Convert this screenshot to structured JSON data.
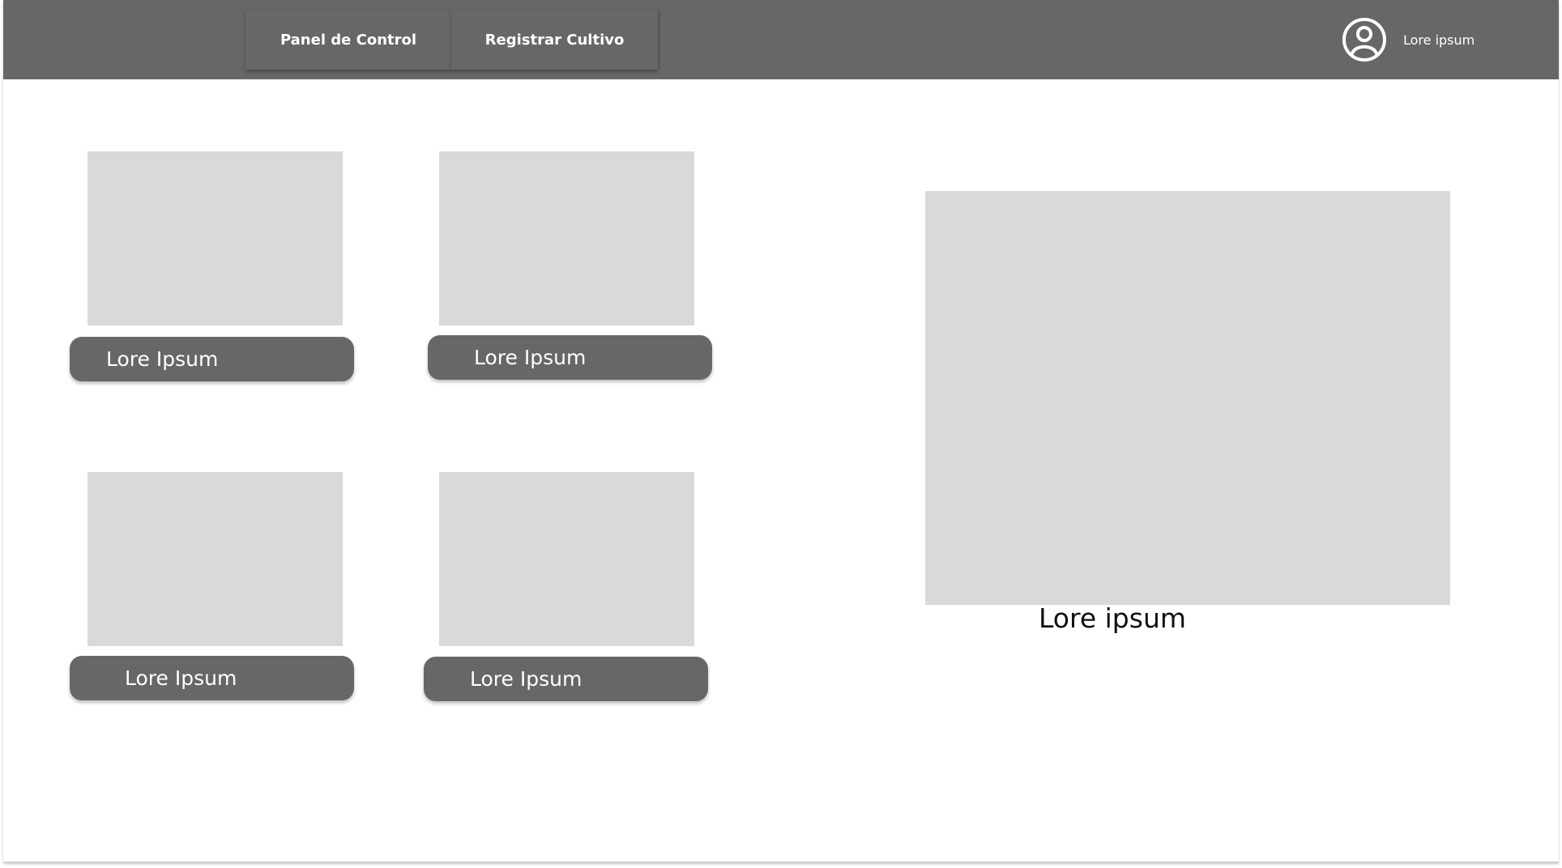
{
  "navigation": {
    "tabs": [
      {
        "label": "Panel de Control"
      },
      {
        "label": "Registrar Cultivo"
      }
    ]
  },
  "user": {
    "name": "Lore ipsum",
    "icon": "user-circle-icon"
  },
  "cards": [
    {
      "button_label": "Lore Ipsum"
    },
    {
      "button_label": "Lore Ipsum"
    },
    {
      "button_label": "Lore Ipsum"
    },
    {
      "button_label": "Lore Ipsum"
    }
  ],
  "featured": {
    "caption": "Lore ipsum"
  },
  "colors": {
    "header_background": "#676767",
    "placeholder": "#d9d9d9",
    "button_background": "#676767",
    "text_on_dark": "#ffffff",
    "page_background": "#ffffff"
  }
}
